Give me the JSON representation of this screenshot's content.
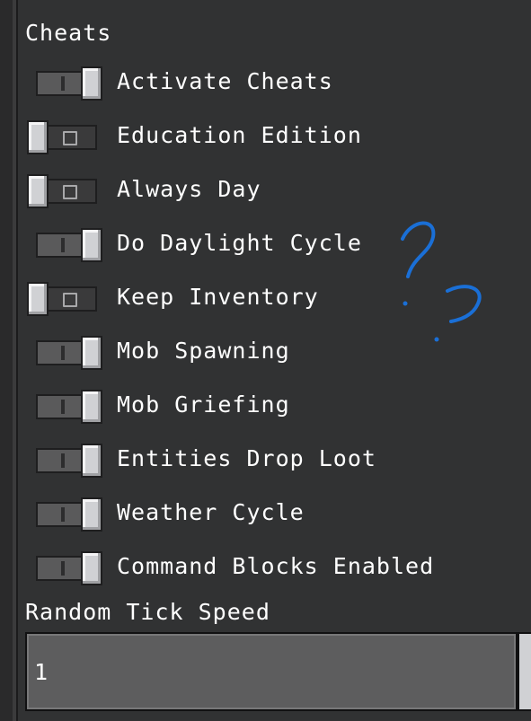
{
  "section_title": "Cheats",
  "toggles": [
    {
      "label": "Activate Cheats",
      "state": "on"
    },
    {
      "label": "Education Edition",
      "state": "off"
    },
    {
      "label": "Always Day",
      "state": "off"
    },
    {
      "label": "Do Daylight Cycle",
      "state": "on"
    },
    {
      "label": "Keep Inventory",
      "state": "off"
    },
    {
      "label": "Mob Spawning",
      "state": "on"
    },
    {
      "label": "Mob Griefing",
      "state": "on"
    },
    {
      "label": "Entities Drop Loot",
      "state": "on"
    },
    {
      "label": "Weather Cycle",
      "state": "on"
    },
    {
      "label": "Command Blocks Enabled",
      "state": "on"
    }
  ],
  "random_tick_speed": {
    "label": "Random Tick Speed",
    "value": "1"
  },
  "colors": {
    "background": "#313233",
    "toggle_knob": "#d0d1d4",
    "annotation": "#1a6fd6"
  }
}
